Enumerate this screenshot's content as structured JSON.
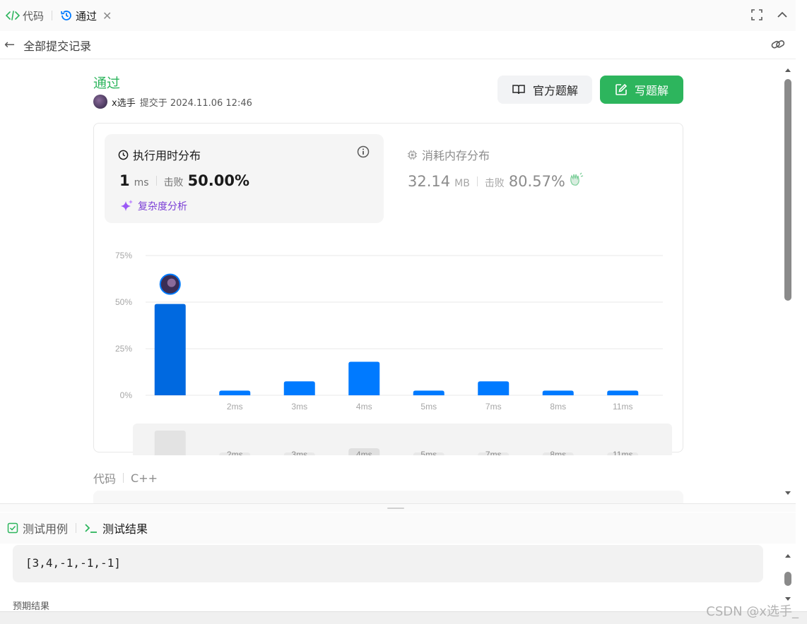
{
  "tabs": {
    "code": "代码",
    "submission": "通过"
  },
  "subbar": {
    "title": "全部提交记录"
  },
  "submission": {
    "status": "通过",
    "user": "x选手",
    "submitted_at": "提交于 2024.11.06 12:46",
    "official_solution": "官方题解",
    "write_solution": "写题解"
  },
  "runtime": {
    "title": "执行用时分布",
    "value": "1",
    "unit": "ms",
    "beats_label": "击败",
    "beats": "50.00%",
    "complexity": "复杂度分析"
  },
  "memory": {
    "title": "消耗内存分布",
    "value": "32.14",
    "unit": "MB",
    "beats_label": "击败",
    "beats": "80.57%"
  },
  "chart_data": {
    "type": "bar",
    "categories": [
      "",
      "2ms",
      "3ms",
      "4ms",
      "5ms",
      "7ms",
      "8ms",
      "11ms"
    ],
    "values": [
      49,
      2.5,
      7.5,
      18,
      2.5,
      7.5,
      2.5,
      2.5
    ],
    "yticks": [
      "75%",
      "50%",
      "25%",
      "0%"
    ],
    "ylim": [
      0,
      75
    ],
    "highlight_index": 0,
    "colors": {
      "bar": "#007aff",
      "highlight": "#0069e0",
      "grid": "#e8e8e8"
    }
  },
  "code": {
    "label": "代码",
    "language": "C++"
  },
  "bottom_tabs": {
    "testcase": "测试用例",
    "result": "测试结果"
  },
  "testcase": {
    "input": "[3,4,-1,-1,-1]",
    "expected_label": "预期结果"
  },
  "watermark": "CSDN @x选手_"
}
